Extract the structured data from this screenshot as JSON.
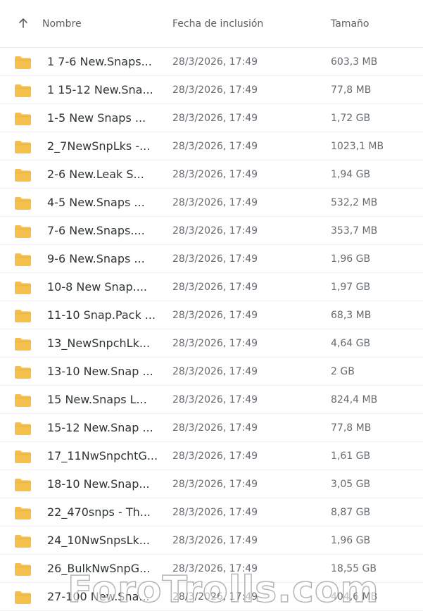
{
  "header": {
    "name_label": "Nombre",
    "date_label": "Fecha de inclusión",
    "size_label": "Tamaño",
    "sort_icon": "arrow-up-icon"
  },
  "icons": {
    "folder": "folder-icon",
    "folder_color": "#F6C04E"
  },
  "files": [
    {
      "name": "1 7-6 New.Snaps...",
      "date": "28/3/2026, 17:49",
      "size": "603,3 MB"
    },
    {
      "name": "1 15-12 New.Sna...",
      "date": "28/3/2026, 17:49",
      "size": "77,8 MB"
    },
    {
      "name": "1-5 New Snaps ...",
      "date": "28/3/2026, 17:49",
      "size": "1,72 GB"
    },
    {
      "name": "2_7NewSnpLks -...",
      "date": "28/3/2026, 17:49",
      "size": "1023,1 MB"
    },
    {
      "name": "2-6 New.Leak S...",
      "date": "28/3/2026, 17:49",
      "size": "1,94 GB"
    },
    {
      "name": "4-5 New.Snaps ...",
      "date": "28/3/2026, 17:49",
      "size": "532,2 MB"
    },
    {
      "name": "7-6 New.Snaps....",
      "date": "28/3/2026, 17:49",
      "size": "353,7 MB"
    },
    {
      "name": "9-6 New.Snaps ...",
      "date": "28/3/2026, 17:49",
      "size": "1,96 GB"
    },
    {
      "name": "10-8 New Snap....",
      "date": "28/3/2026, 17:49",
      "size": "1,97 GB"
    },
    {
      "name": "11-10 Snap.Pack ...",
      "date": "28/3/2026, 17:49",
      "size": "68,3 MB"
    },
    {
      "name": "13_NewSnpchLk...",
      "date": "28/3/2026, 17:49",
      "size": "4,64 GB"
    },
    {
      "name": "13-10 New.Snap ...",
      "date": "28/3/2026, 17:49",
      "size": "2 GB"
    },
    {
      "name": "15 New.Snaps L...",
      "date": "28/3/2026, 17:49",
      "size": "824,4 MB"
    },
    {
      "name": "15-12 New.Snap ...",
      "date": "28/3/2026, 17:49",
      "size": "77,8 MB"
    },
    {
      "name": "17_11NwSnpchtG...",
      "date": "28/3/2026, 17:49",
      "size": "1,61 GB"
    },
    {
      "name": "18-10 New.Snap...",
      "date": "28/3/2026, 17:49",
      "size": "3,05 GB"
    },
    {
      "name": "22_470snps - Th...",
      "date": "28/3/2026, 17:49",
      "size": "8,87 GB"
    },
    {
      "name": "24_10NwSnpsLk...",
      "date": "28/3/2026, 17:49",
      "size": "1,96 GB"
    },
    {
      "name": "26_BulkNwSnpG...",
      "date": "28/3/2026, 17:49",
      "size": "18,55 GB"
    },
    {
      "name": "27-100 New.Sna...",
      "date": "28/3/2026, 17:49",
      "size": "404,6 MB"
    }
  ],
  "watermark": "ForoTrolls.com"
}
